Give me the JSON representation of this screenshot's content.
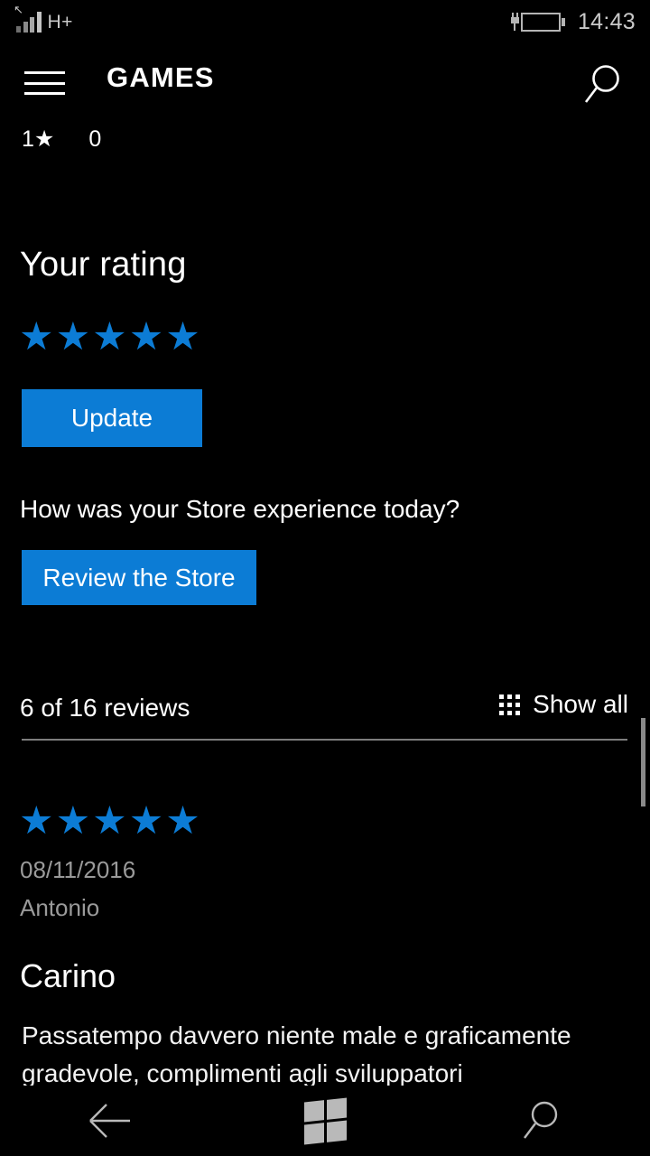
{
  "status_bar": {
    "network_label": "H+",
    "signal_icon": "signal-bars-icon",
    "battery_icon": "battery-charging-icon",
    "clock": "14:43"
  },
  "app_bar": {
    "menu_icon": "hamburger-menu-icon",
    "title": "GAMES",
    "search_icon": "search-icon"
  },
  "rating_histogram": {
    "label": "1★",
    "count": "0"
  },
  "your_rating": {
    "heading": "Your rating",
    "stars": 5,
    "star_glyph": "★",
    "update_label": "Update"
  },
  "store_feedback": {
    "question": "How was your Store experience today?",
    "review_store_label": "Review the Store"
  },
  "reviews_header": {
    "count_text": "6 of 16 reviews",
    "grid_icon": "grid-dots-icon",
    "show_all_label": "Show all"
  },
  "review": {
    "stars": 5,
    "star_glyph": "★",
    "date": "08/11/2016",
    "author": "Antonio",
    "title": "Carino",
    "body": "Passatempo davvero niente male e graficamente gradevole, complimenti agli sviluppatori"
  },
  "nav_bar": {
    "back_icon": "back-arrow-icon",
    "home_icon": "windows-home-icon",
    "search_icon": "search-icon"
  },
  "colors": {
    "accent": "#0c7cd5",
    "background": "#000000",
    "text": "#ffffff",
    "muted_text": "#9a9a9a",
    "divider": "#7d7d7d"
  }
}
